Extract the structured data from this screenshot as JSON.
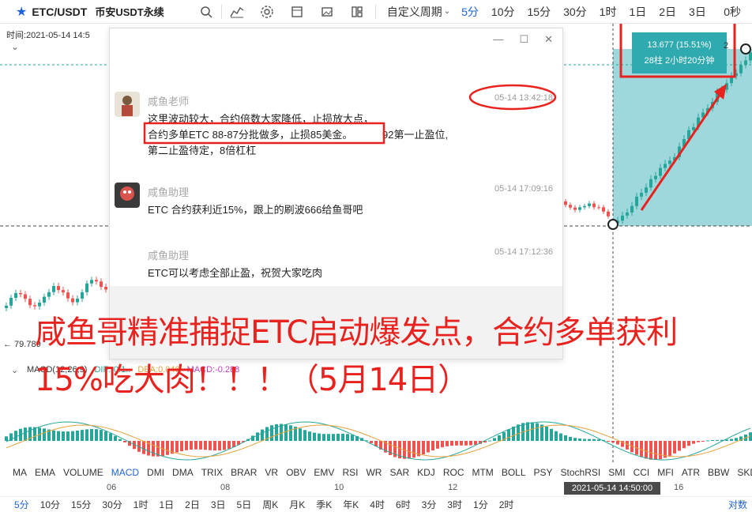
{
  "toolbar": {
    "symbol": "ETC/USDT",
    "market": "币安USDT永续",
    "custom_period": "自定义周期",
    "periods": [
      "5分",
      "10分",
      "15分",
      "30分",
      "1时",
      "1日",
      "2日",
      "3日"
    ],
    "active_period": "5分",
    "countdown": "0秒"
  },
  "chart": {
    "time_label": "时间:2021-05-14 14:5",
    "low_price": "← 79.789",
    "macd_label": {
      "name": "MACD(12,26,9)",
      "dif": "DIF:-0.1..",
      "dea": "DEA:0.046",
      "macd": "MACD:-0.288"
    },
    "tooltip": {
      "change": "13.677 (15.51%)",
      "duration": "28柱  2小时20分钟"
    },
    "price_right": "2"
  },
  "chat": {
    "messages": [
      {
        "sender": "咸鱼老师",
        "time": "05-14 13:42:18",
        "lines": [
          "这里波动较大，合约倍数大家降低，止损放大点，",
          "合约多单ETC      88-87分批做多，止损85美金。",
          "92第一止盈位,",
          "第二止盈待定，8倍杠杠"
        ]
      },
      {
        "sender": "咸鱼助理",
        "time": "05-14 17:09:16",
        "lines": [
          "ETC 合约获利近15%，跟上的刷波666给鱼哥吧"
        ]
      },
      {
        "sender": "咸鱼助理",
        "time": "05-14 17:12:36",
        "lines": [
          "ETC可以考虑全部止盈，祝贺大家吃肉"
        ]
      }
    ]
  },
  "captions": {
    "line1": "咸鱼哥精准捕捉ETC启动爆发点，合约多单获利",
    "line2": "15%吃大肉！！！（5月14日）"
  },
  "indicators": [
    "MA",
    "EMA",
    "VOLUME",
    "MACD",
    "DMI",
    "DMA",
    "TRIX",
    "BRAR",
    "VR",
    "OBV",
    "EMV",
    "RSI",
    "WR",
    "SAR",
    "KDJ",
    "ROC",
    "MTM",
    "BOLL",
    "PSY",
    "StochRSI",
    "SMI",
    "CCI",
    "MFI",
    "ATR",
    "BBW",
    "SKDJ"
  ],
  "active_indicator": "MACD",
  "xaxis": {
    "ticks": [
      "06",
      "08",
      "10",
      "12",
      "16"
    ],
    "cursor_date": "2021-05-14 14:50:00"
  },
  "bottom_periods": [
    "5分",
    "10分",
    "15分",
    "30分",
    "1时",
    "1日",
    "2日",
    "3日",
    "5日",
    "周K",
    "月K",
    "季K",
    "年K",
    "4时",
    "6时",
    "3分",
    "3时",
    "1分",
    "2时"
  ],
  "active_bottom_period": "5分",
  "scale_mode": "对数",
  "colors": {
    "up": "#26a69a",
    "down": "#ef5350",
    "accent": "#1e63d6",
    "annotation": "#e8231f",
    "highlight": "#7ecbd2"
  }
}
